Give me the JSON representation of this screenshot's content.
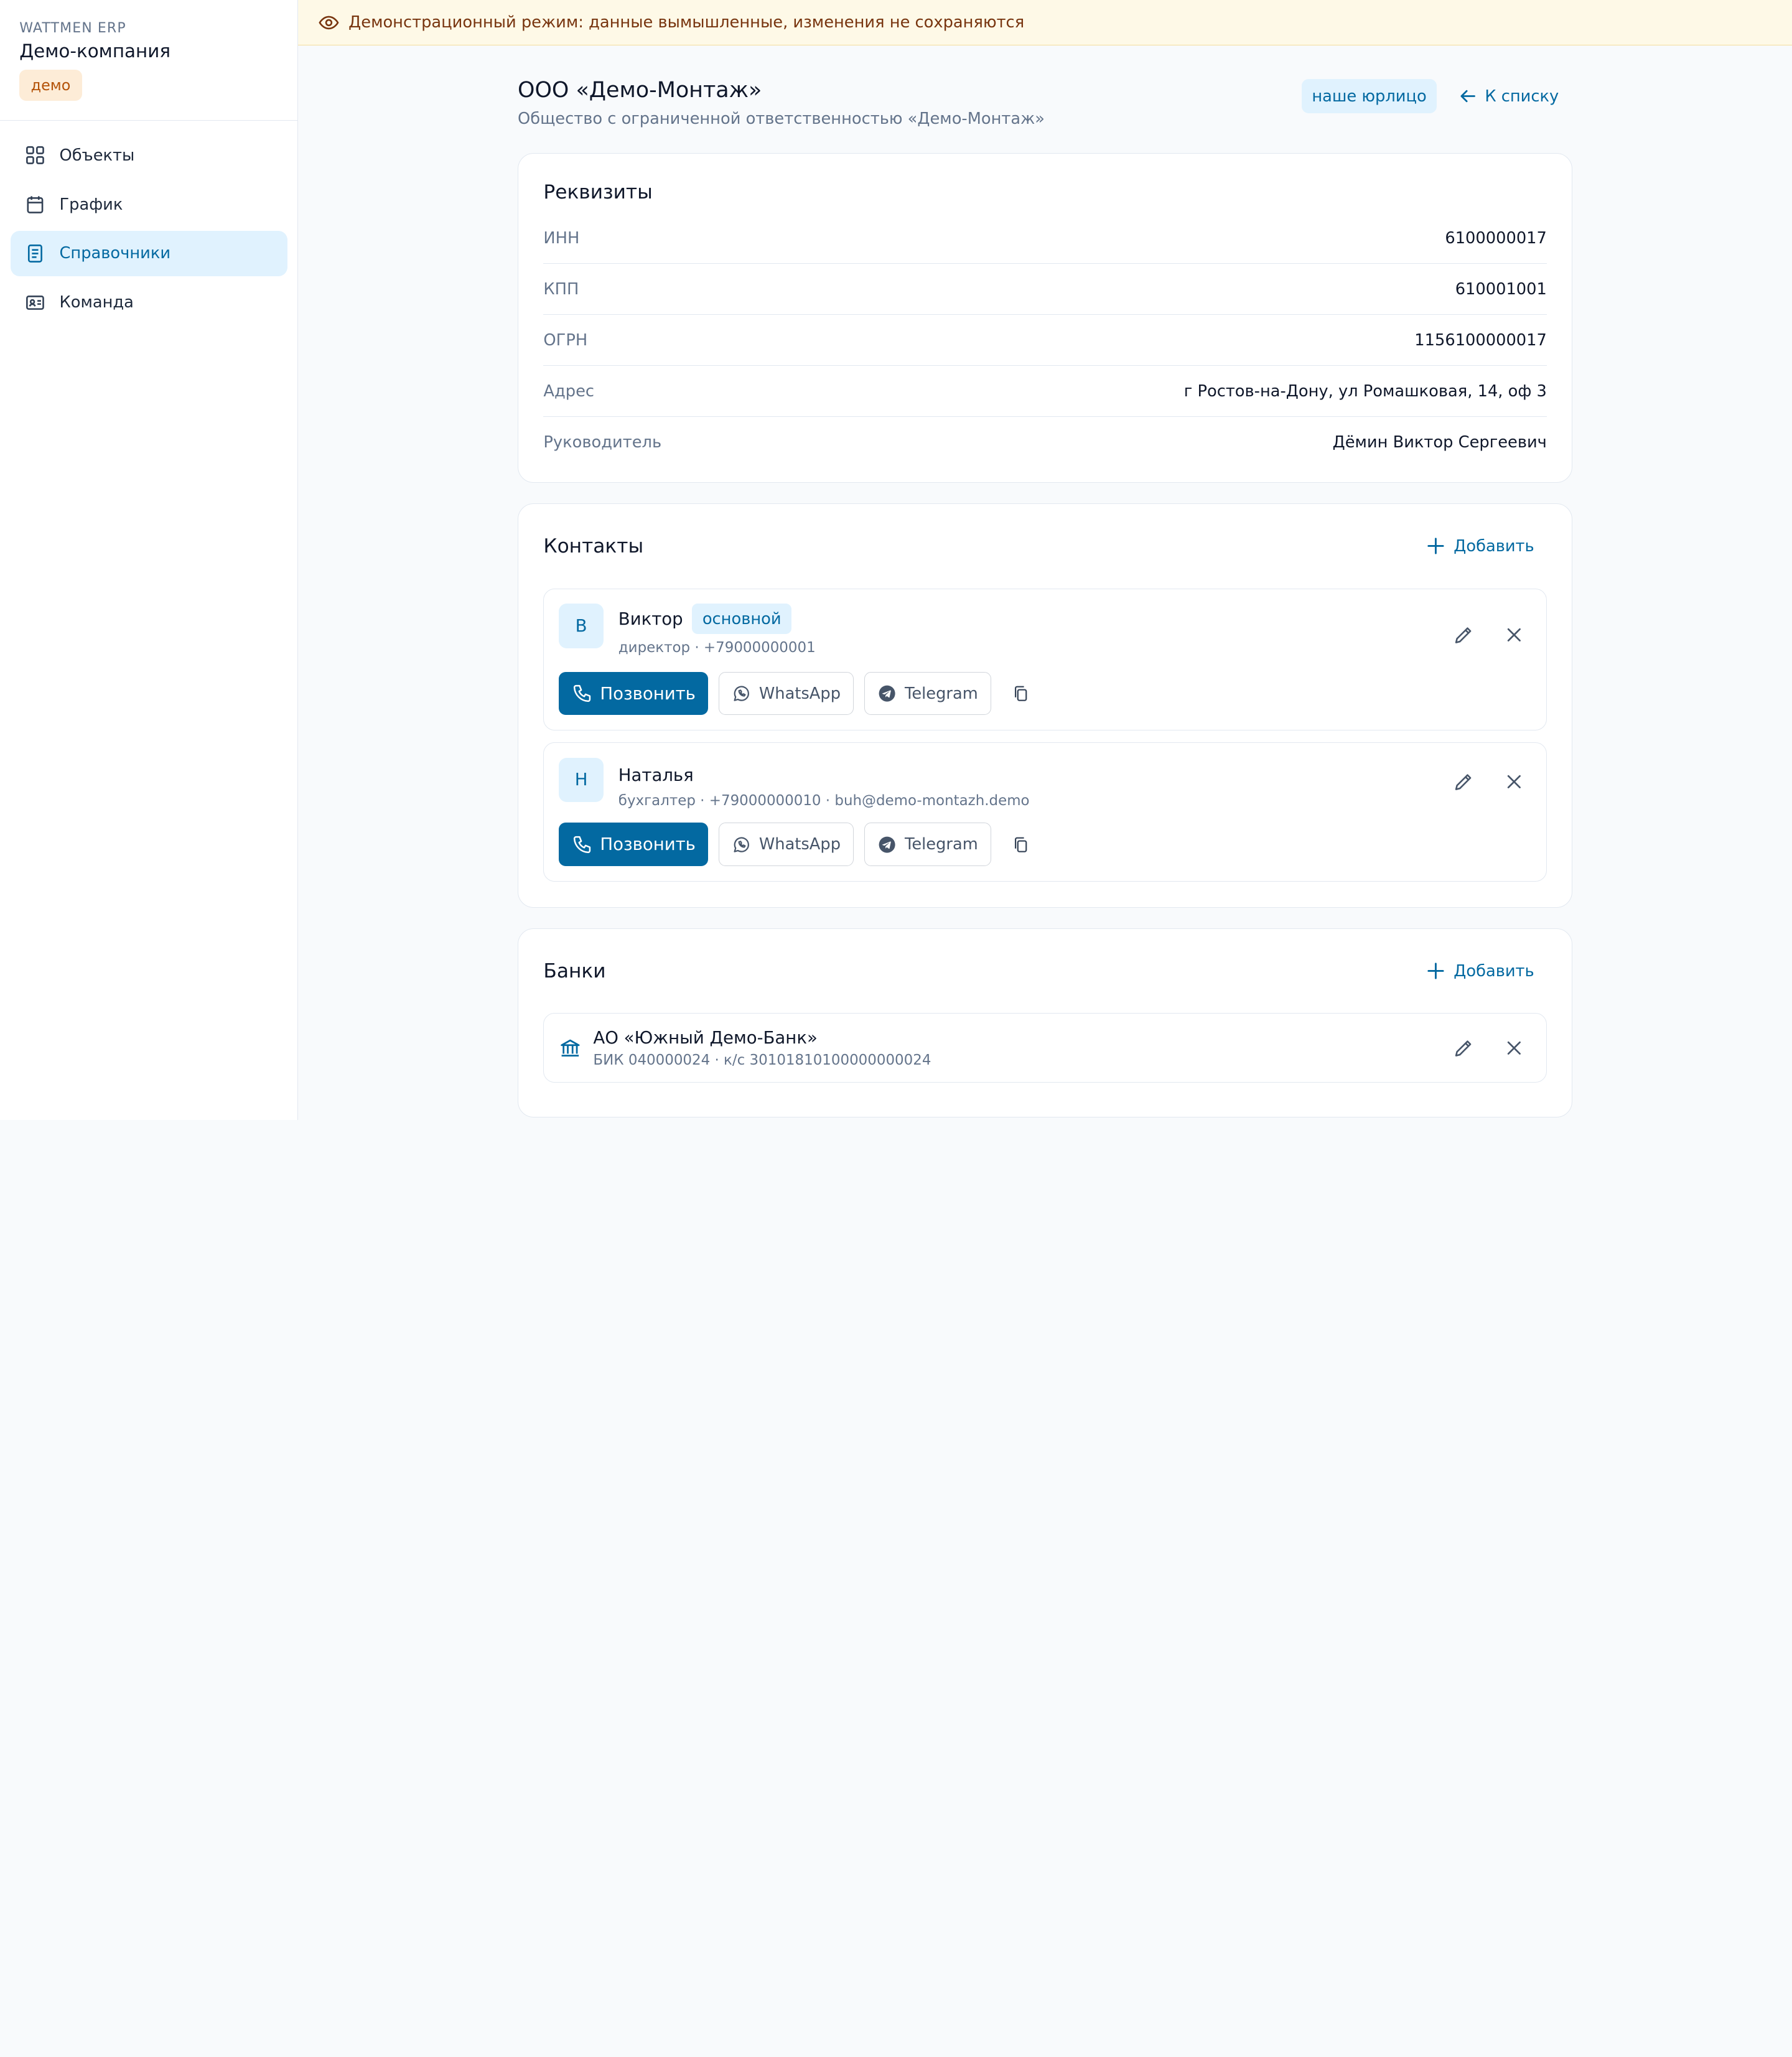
{
  "sidebar": {
    "brand_sub": "WATTMEN ERP",
    "company": "Демо-компания",
    "badge": "демо",
    "items": [
      {
        "label": "Объекты",
        "icon": "grid-icon"
      },
      {
        "label": "График",
        "icon": "calendar-icon"
      },
      {
        "label": "Справочники",
        "icon": "document-icon",
        "active": true
      },
      {
        "label": "Команда",
        "icon": "id-card-icon"
      }
    ]
  },
  "banner": {
    "text": "Демонстрационный режим: данные вымышленные, изменения не сохраняются",
    "icon": "eye-icon"
  },
  "page": {
    "title": "ООО «Демо-Монтаж»",
    "subtitle": "Общество с ограниченной ответственностью «Демо-Монтаж»",
    "badge": "наше юрлицо",
    "back_label": "К списку"
  },
  "requisites": {
    "title": "Реквизиты",
    "rows": [
      {
        "label": "ИНН",
        "value": "6100000017"
      },
      {
        "label": "КПП",
        "value": "610001001"
      },
      {
        "label": "ОГРН",
        "value": "1156100000017"
      },
      {
        "label": "Адрес",
        "value": "г Ростов-на-Дону, ул Ромашковая, 14, оф 3"
      },
      {
        "label": "Руководитель",
        "value": "Дёмин Виктор Сергеевич"
      }
    ]
  },
  "contacts": {
    "title": "Контакты",
    "add_label": "Добавить",
    "call_label": "Позвонить",
    "whatsapp_label": "WhatsApp",
    "telegram_label": "Telegram",
    "items": [
      {
        "initial": "В",
        "name": "Виктор",
        "tag": "основной",
        "meta": "директор · +79000000001"
      },
      {
        "initial": "Н",
        "name": "Наталья",
        "tag": "",
        "meta": "бухгалтер · +79000000010 · buh@demo-montazh.demo"
      }
    ]
  },
  "banks": {
    "title": "Банки",
    "add_label": "Добавить",
    "items": [
      {
        "name": "АО «Южный Демо-Банк»",
        "meta": "БИК 040000024 · к/с 30101810100000000024"
      }
    ]
  },
  "colors": {
    "accent": "#0369a1",
    "accent_light": "#e0f2fe",
    "banner_bg": "#fef9e7",
    "demo_badge_bg": "#fdecd7"
  }
}
